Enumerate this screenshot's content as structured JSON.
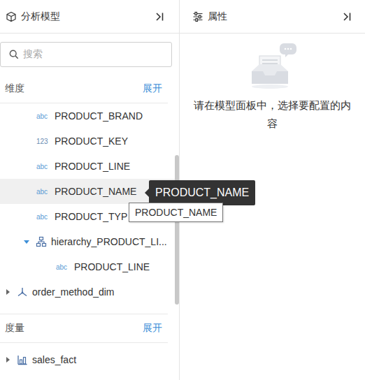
{
  "left_panel": {
    "title": "分析模型"
  },
  "search": {
    "placeholder": "搜索"
  },
  "dimensions": {
    "title": "维度",
    "action": "展开",
    "items": [
      {
        "kind": "field",
        "type": "abc",
        "name": "PRODUCT_BRAND",
        "hovered": false
      },
      {
        "kind": "field",
        "type": "123",
        "name": "PRODUCT_KEY",
        "hovered": false
      },
      {
        "kind": "field",
        "type": "abc",
        "name": "PRODUCT_LINE",
        "hovered": false
      },
      {
        "kind": "field",
        "type": "abc",
        "name": "PRODUCT_NAME",
        "hovered": true
      },
      {
        "kind": "field",
        "type": "abc",
        "name": "PRODUCT_TYP",
        "hovered": false
      },
      {
        "kind": "hierarchy",
        "name": "hierarchy_PRODUCT_LI...",
        "expanded": true,
        "hovered": false,
        "children": [
          {
            "kind": "field",
            "type": "abc",
            "name": "PRODUCT_LINE",
            "hovered": false
          }
        ]
      },
      {
        "kind": "dimension",
        "name": "order_method_dim",
        "expanded": false,
        "hovered": false
      }
    ]
  },
  "measures": {
    "title": "度量",
    "action": "展开",
    "items": [
      {
        "kind": "measure",
        "name": "sales_fact",
        "expanded": false,
        "hovered": false
      }
    ]
  },
  "tooltips": [
    {
      "kind": "dark",
      "text": "PRODUCT_NAME"
    },
    {
      "kind": "native",
      "text": "PRODUCT_NAME"
    }
  ],
  "right_panel": {
    "title": "属性",
    "empty_message": "请在模型面板中，选择要配置的内容"
  }
}
